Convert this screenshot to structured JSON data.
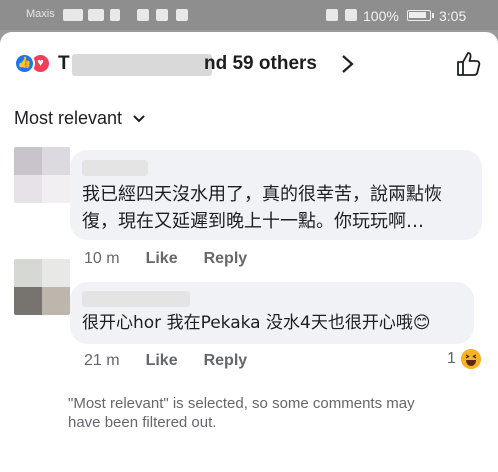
{
  "status_bar": {
    "carrier": "Maxis",
    "battery": "100%",
    "time": "3:05"
  },
  "header": {
    "reactors_prefix": "T",
    "reactors_text": "nd 59 others"
  },
  "sort": {
    "label": "Most relevant"
  },
  "comments": [
    {
      "text_line1": "我已經四天沒水用了，真的很幸苦，說兩點恢",
      "text_line2": "復，現在又延遲到晚上十一點。你玩玩啊…",
      "time": "10 m",
      "like_label": "Like",
      "reply_label": "Reply"
    },
    {
      "text": "很开心hor 我在Pekaka 没水4天也很开心哦😊",
      "time": "21 m",
      "like_label": "Like",
      "reply_label": "Reply",
      "reaction_count": "1",
      "reaction_icon": "haha-icon"
    }
  ],
  "footer": {
    "filter_note": "\"Most relevant\" is selected, so some comments may have been filtered out."
  },
  "colors": {
    "accent_blue": "#1877f2",
    "love_red": "#f33e58",
    "haha_yellow": "#f7b125",
    "bubble_bg": "#f0f2f5",
    "secondary_text": "#65676b"
  }
}
